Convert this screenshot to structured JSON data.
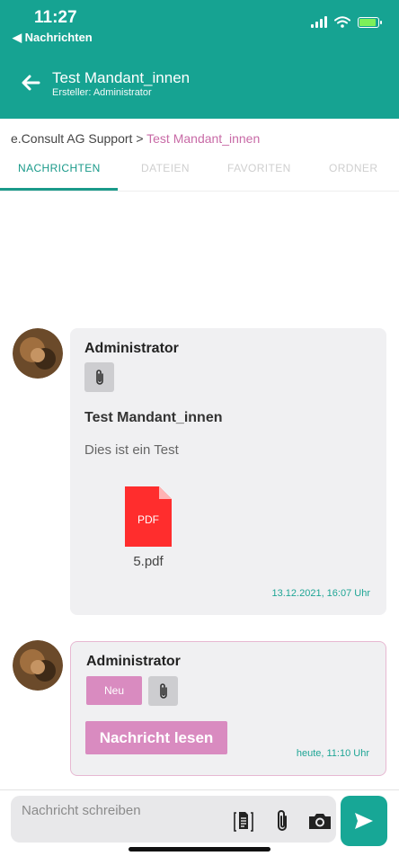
{
  "status_bar": {
    "time": "11:27",
    "back_label": "◀ Nachrichten"
  },
  "header": {
    "title": "Test Mandant_innen",
    "subtitle": "Ersteller: Administrator"
  },
  "breadcrumb": {
    "root": "e.Consult AG Support",
    "separator": ">",
    "current": "Test Mandant_innen"
  },
  "tabs": [
    {
      "label": "NACHRICHTEN",
      "active": true
    },
    {
      "label": "DATEIEN",
      "active": false
    },
    {
      "label": "FAVORITEN",
      "active": false
    },
    {
      "label": "ORDNER",
      "active": false
    }
  ],
  "messages": [
    {
      "author": "Administrator",
      "subject": "Test Mandant_innen",
      "body": "Dies ist ein Test",
      "attachment": {
        "type_label": "PDF",
        "name": "5.pdf"
      },
      "timestamp": "13.12.2021, 16:07 Uhr"
    },
    {
      "author": "Administrator",
      "badge": "Neu",
      "action_label": "Nachricht lesen",
      "timestamp": "heute, 11:10 Uhr"
    }
  ],
  "compose": {
    "placeholder": "Nachricht schreiben"
  },
  "colors": {
    "brand": "#16a392",
    "accent_pink": "#d98bc0",
    "link_pink": "#c86aa6",
    "card_bg": "#f0f0f2"
  },
  "icons": [
    "back-arrow-icon",
    "paperclip-icon",
    "pdf-file-icon",
    "document-icon",
    "camera-icon",
    "send-icon",
    "wifi-icon",
    "signal-icon",
    "battery-icon"
  ]
}
